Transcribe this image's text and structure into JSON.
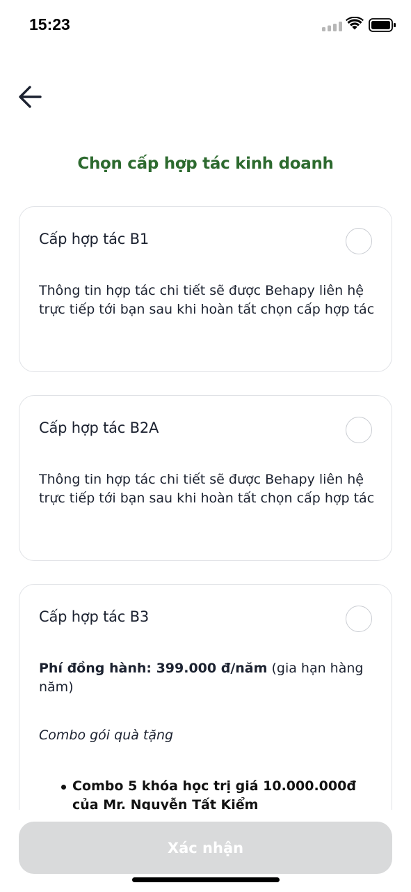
{
  "status_bar": {
    "time": "15:23"
  },
  "header": {
    "title": "Chọn cấp hợp tác kinh doanh"
  },
  "cards": [
    {
      "title": "Cấp hợp tác B1",
      "description": "Thông tin hợp tác chi tiết sẽ được Behapy liên hệ trực tiếp tới bạn sau khi hoàn tất chọn cấp hợp tác",
      "selected": false
    },
    {
      "title": "Cấp hợp tác B2A",
      "description": "Thông tin hợp tác chi tiết sẽ được Behapy liên hệ trực tiếp tới bạn sau khi hoàn tất chọn cấp hợp tác",
      "selected": false
    },
    {
      "title": "Cấp hợp tác B3",
      "fee_bold": "Phí đồng hành: 399.000 đ/năm",
      "fee_note": " (gia hạn hàng năm)",
      "combo_label": "Combo gói quà tặng",
      "items": [
        "Combo 5 khóa học trị giá 10.000.000đ của Mr. Nguyễn Tất Kiểm"
      ],
      "selected": false
    }
  ],
  "footer": {
    "confirm_label": "Xác nhận",
    "confirm_enabled": false
  },
  "colors": {
    "title_green": "#2d6a2f",
    "button_disabled": "#d9dadb",
    "border": "#e0e2e6"
  },
  "icons": {
    "back": "arrow-left-icon",
    "signal": "cellular-signal-icon",
    "wifi": "wifi-icon",
    "battery": "battery-icon"
  }
}
